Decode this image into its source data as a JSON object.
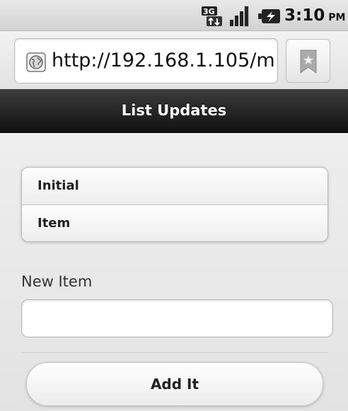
{
  "status_bar": {
    "network_icon": "3g-data-icon",
    "signal_icon": "signal-strength-icon",
    "battery_icon": "battery-charging-icon",
    "time": "3:10",
    "ampm": "PM"
  },
  "browser": {
    "url": "http://192.168.1.105/m…",
    "site_icon": "globe-icon",
    "bookmark_icon": "bookmark-star-icon"
  },
  "header": {
    "title": "List Updates"
  },
  "list": {
    "items": [
      {
        "label": "Initial"
      },
      {
        "label": "Item"
      }
    ]
  },
  "form": {
    "new_item_label": "New Item",
    "new_item_value": "",
    "new_item_placeholder": "",
    "add_button_label": "Add It"
  },
  "colors": {
    "header_bg": "#1e1e1e",
    "header_text": "#ffffff",
    "content_bg": "#e9e9e9"
  }
}
